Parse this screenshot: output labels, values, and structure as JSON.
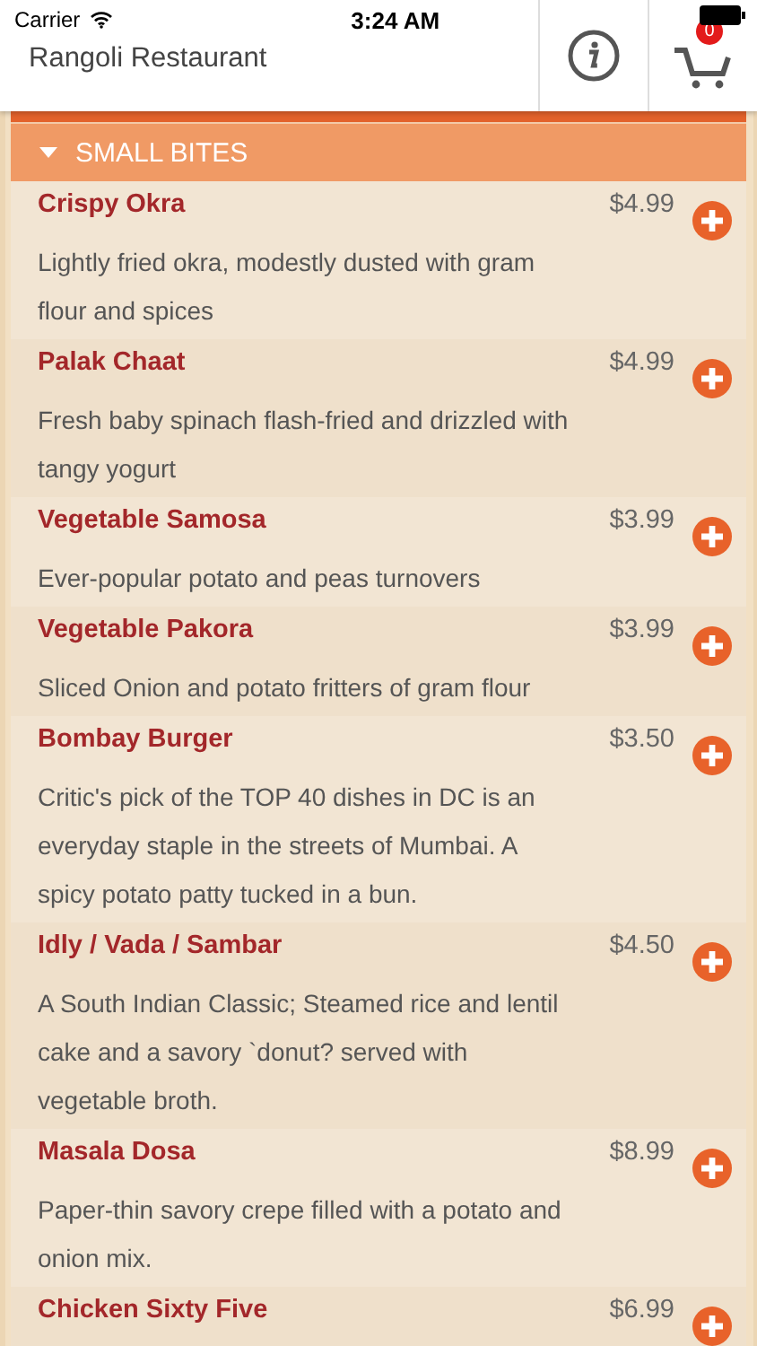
{
  "status_bar": {
    "carrier": "Carrier",
    "time": "3:24 AM"
  },
  "header": {
    "title": "Rangoli Restaurant",
    "cart_count": "0"
  },
  "section": {
    "title": "SMALL BITES",
    "expanded": true
  },
  "items": [
    {
      "name": "Crispy Okra",
      "price": "$4.99",
      "description": "Lightly fried okra, modestly dusted with gram flour and spices"
    },
    {
      "name": "Palak Chaat",
      "price": "$4.99",
      "description": "Fresh baby spinach flash-fried and drizzled with tangy yogurt"
    },
    {
      "name": "Vegetable Samosa",
      "price": "$3.99",
      "description": "Ever-popular potato and peas turnovers"
    },
    {
      "name": "Vegetable Pakora",
      "price": "$3.99",
      "description": "Sliced Onion and potato fritters of gram flour"
    },
    {
      "name": "Bombay Burger",
      "price": "$3.50",
      "description": "Critic's pick of the TOP 40 dishes in DC is an everyday staple in the streets of Mumbai. A spicy potato patty tucked in a bun."
    },
    {
      "name": "Idly / Vada / Sambar",
      "price": "$4.50",
      "description": "A South Indian Classic; Steamed rice and lentil cake and a savory `donut? served with vegetable broth."
    },
    {
      "name": "Masala Dosa",
      "price": "$8.99",
      "description": "Paper-thin savory crepe filled with a potato and onion mix."
    },
    {
      "name": "Chicken Sixty Five",
      "price": "$6.99"
    }
  ]
}
